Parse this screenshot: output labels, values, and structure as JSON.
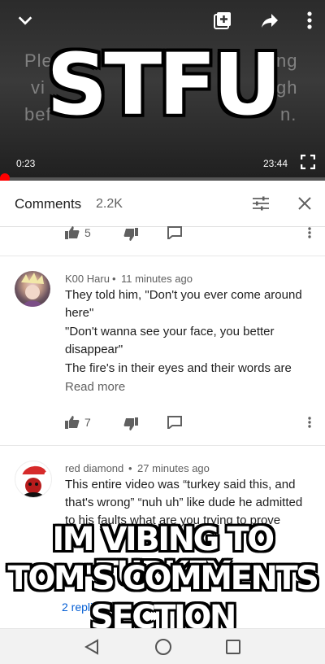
{
  "video": {
    "bg_fragments": [
      "Ple",
      "ng",
      "vi",
      "gh",
      "bef",
      "n."
    ],
    "current_time": "0:23",
    "duration": "23:44",
    "progress_fraction": 0.016
  },
  "meme": {
    "top_text": "STFU",
    "bottom_lines": [
      "IM VIBING TO TURKEY",
      "TOM'S COMMENTS",
      "SECTION"
    ]
  },
  "comments_header": {
    "title": "Comments",
    "count": "2.2K"
  },
  "top_actions": {
    "likes": "5"
  },
  "comments": [
    {
      "author": "K00 Haru",
      "time": "11 minutes ago",
      "lines": [
        "They told him, \"Don't you ever come around",
        "here\"",
        "\"Don't wanna see your face, you better",
        "disappear\"",
        "The fire's in their eyes and their words are"
      ],
      "read_more": "Read more",
      "likes": "7"
    },
    {
      "author": "red diamond",
      "time": "27 minutes ago",
      "lines": [
        "This entire video was “turkey said this, and",
        "that's wrong” “nuh uh” like dude he admitted",
        "to his faults what are you trying to prove"
      ],
      "replies": "2 replies"
    }
  ],
  "colors": {
    "accent_red": "#ff0000",
    "link_blue": "#065fd4"
  }
}
